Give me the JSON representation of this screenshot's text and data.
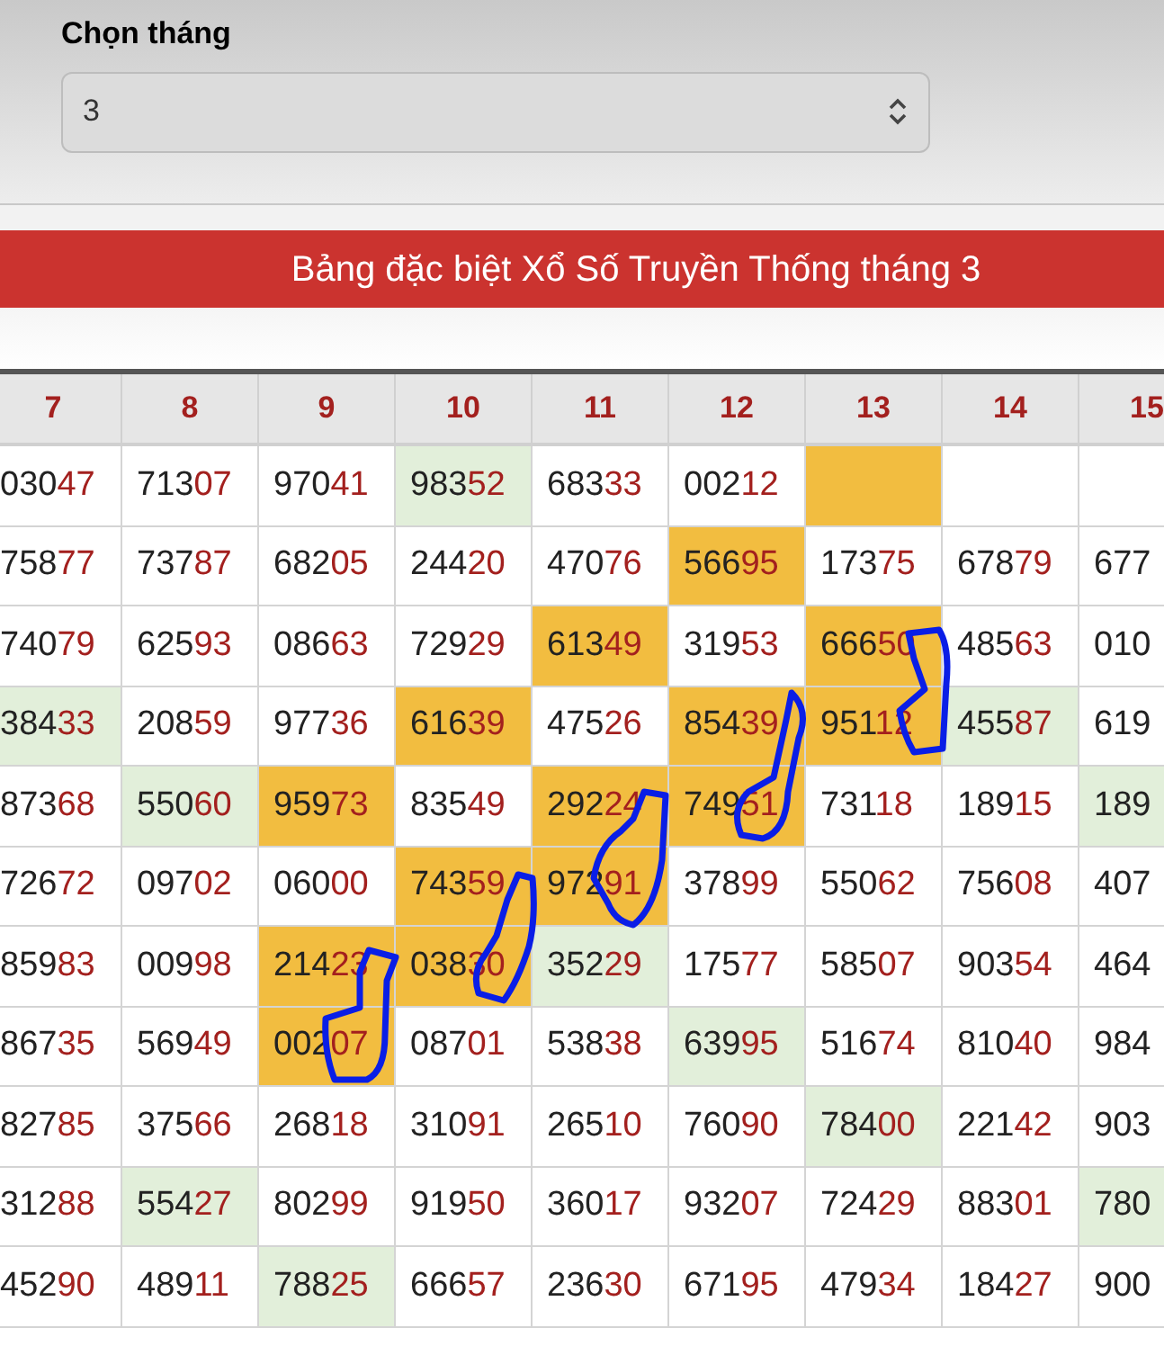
{
  "month_picker": {
    "label": "Chọn tháng",
    "value": "3"
  },
  "banner": {
    "title": "Bảng đặc biệt Xổ Số Truyền Thống tháng 3"
  },
  "table": {
    "columns": [
      "7",
      "8",
      "9",
      "10",
      "11",
      "12",
      "13",
      "14",
      "15"
    ],
    "rows": [
      [
        {
          "digits": "030",
          "tail": "47"
        },
        {
          "digits": "713",
          "tail": "07"
        },
        {
          "digits": "970",
          "tail": "41"
        },
        {
          "digits": "983",
          "tail": "52",
          "color": "#e2efda"
        },
        {
          "digits": "683",
          "tail": "33"
        },
        {
          "digits": "002",
          "tail": "12"
        },
        {
          "color": "#f2bd40"
        },
        {},
        {}
      ],
      [
        {
          "digits": "758",
          "tail": "77"
        },
        {
          "digits": "737",
          "tail": "87"
        },
        {
          "digits": "682",
          "tail": "05"
        },
        {
          "digits": "244",
          "tail": "20"
        },
        {
          "digits": "470",
          "tail": "76"
        },
        {
          "digits": "566",
          "tail": "95",
          "color": "#f2bd40"
        },
        {
          "digits": "173",
          "tail": "75"
        },
        {
          "digits": "678",
          "tail": "79"
        },
        {
          "digits": "677"
        }
      ],
      [
        {
          "digits": "740",
          "tail": "79"
        },
        {
          "digits": "625",
          "tail": "93"
        },
        {
          "digits": "086",
          "tail": "63"
        },
        {
          "digits": "729",
          "tail": "29"
        },
        {
          "digits": "613",
          "tail": "49",
          "color": "#f2bd40"
        },
        {
          "digits": "319",
          "tail": "53"
        },
        {
          "digits": "666",
          "tail": "50",
          "color": "#f2bd40"
        },
        {
          "digits": "485",
          "tail": "63"
        },
        {
          "digits": "010"
        }
      ],
      [
        {
          "digits": "384",
          "tail": "33",
          "color": "#e2efda"
        },
        {
          "digits": "208",
          "tail": "59"
        },
        {
          "digits": "977",
          "tail": "36"
        },
        {
          "digits": "616",
          "tail": "39",
          "color": "#f2bd40"
        },
        {
          "digits": "475",
          "tail": "26"
        },
        {
          "digits": "854",
          "tail": "39",
          "color": "#f2bd40"
        },
        {
          "digits": "951",
          "tail": "12",
          "color": "#f2bd40"
        },
        {
          "digits": "455",
          "tail": "87",
          "color": "#e2efda"
        },
        {
          "digits": "619"
        }
      ],
      [
        {
          "digits": "873",
          "tail": "68"
        },
        {
          "digits": "550",
          "tail": "60",
          "color": "#e2efda"
        },
        {
          "digits": "959",
          "tail": "73",
          "color": "#f2bd40"
        },
        {
          "digits": "835",
          "tail": "49"
        },
        {
          "digits": "292",
          "tail": "24",
          "color": "#f2bd40"
        },
        {
          "digits": "749",
          "tail": "51",
          "color": "#f2bd40"
        },
        {
          "digits": "731",
          "tail": "18"
        },
        {
          "digits": "189",
          "tail": "15"
        },
        {
          "digits": "189",
          "color": "#e2efda"
        }
      ],
      [
        {
          "digits": "726",
          "tail": "72"
        },
        {
          "digits": "097",
          "tail": "02"
        },
        {
          "digits": "060",
          "tail": "00"
        },
        {
          "digits": "743",
          "tail": "59",
          "color": "#f2bd40"
        },
        {
          "digits": "972",
          "tail": "91",
          "color": "#f2bd40"
        },
        {
          "digits": "378",
          "tail": "99"
        },
        {
          "digits": "550",
          "tail": "62"
        },
        {
          "digits": "756",
          "tail": "08"
        },
        {
          "digits": "407"
        }
      ],
      [
        {
          "digits": "859",
          "tail": "83"
        },
        {
          "digits": "009",
          "tail": "98"
        },
        {
          "digits": "214",
          "tail": "23",
          "color": "#f2bd40"
        },
        {
          "digits": "038",
          "tail": "30",
          "color": "#f2bd40"
        },
        {
          "digits": "352",
          "tail": "29",
          "color": "#e2efda"
        },
        {
          "digits": "175",
          "tail": "77"
        },
        {
          "digits": "585",
          "tail": "07"
        },
        {
          "digits": "903",
          "tail": "54"
        },
        {
          "digits": "464"
        }
      ],
      [
        {
          "digits": "867",
          "tail": "35"
        },
        {
          "digits": "569",
          "tail": "49"
        },
        {
          "digits": "002",
          "tail": "07",
          "color": "#f2bd40"
        },
        {
          "digits": "087",
          "tail": "01"
        },
        {
          "digits": "538",
          "tail": "38"
        },
        {
          "digits": "639",
          "tail": "95",
          "color": "#e2efda"
        },
        {
          "digits": "516",
          "tail": "74"
        },
        {
          "digits": "810",
          "tail": "40"
        },
        {
          "digits": "984"
        }
      ],
      [
        {
          "digits": "827",
          "tail": "85"
        },
        {
          "digits": "375",
          "tail": "66"
        },
        {
          "digits": "268",
          "tail": "18"
        },
        {
          "digits": "310",
          "tail": "91"
        },
        {
          "digits": "265",
          "tail": "10"
        },
        {
          "digits": "760",
          "tail": "90"
        },
        {
          "digits": "784",
          "tail": "00",
          "color": "#e2efda"
        },
        {
          "digits": "221",
          "tail": "42"
        },
        {
          "digits": "903"
        }
      ],
      [
        {
          "digits": "312",
          "tail": "88"
        },
        {
          "digits": "554",
          "tail": "27",
          "color": "#e2efda"
        },
        {
          "digits": "802",
          "tail": "99"
        },
        {
          "digits": "919",
          "tail": "50"
        },
        {
          "digits": "360",
          "tail": "17"
        },
        {
          "digits": "932",
          "tail": "07"
        },
        {
          "digits": "724",
          "tail": "29"
        },
        {
          "digits": "883",
          "tail": "01"
        },
        {
          "digits": "780",
          "color": "#e2efda"
        }
      ],
      [
        {
          "digits": "452",
          "tail": "90"
        },
        {
          "digits": "489",
          "tail": "11"
        },
        {
          "digits": "788",
          "tail": "25",
          "color": "#e2efda"
        },
        {
          "digits": "666",
          "tail": "57"
        },
        {
          "digits": "236",
          "tail": "30"
        },
        {
          "digits": "671",
          "tail": "95"
        },
        {
          "digits": "479",
          "tail": "34"
        },
        {
          "digits": "184",
          "tail": "27"
        },
        {
          "digits": "900"
        }
      ]
    ]
  }
}
